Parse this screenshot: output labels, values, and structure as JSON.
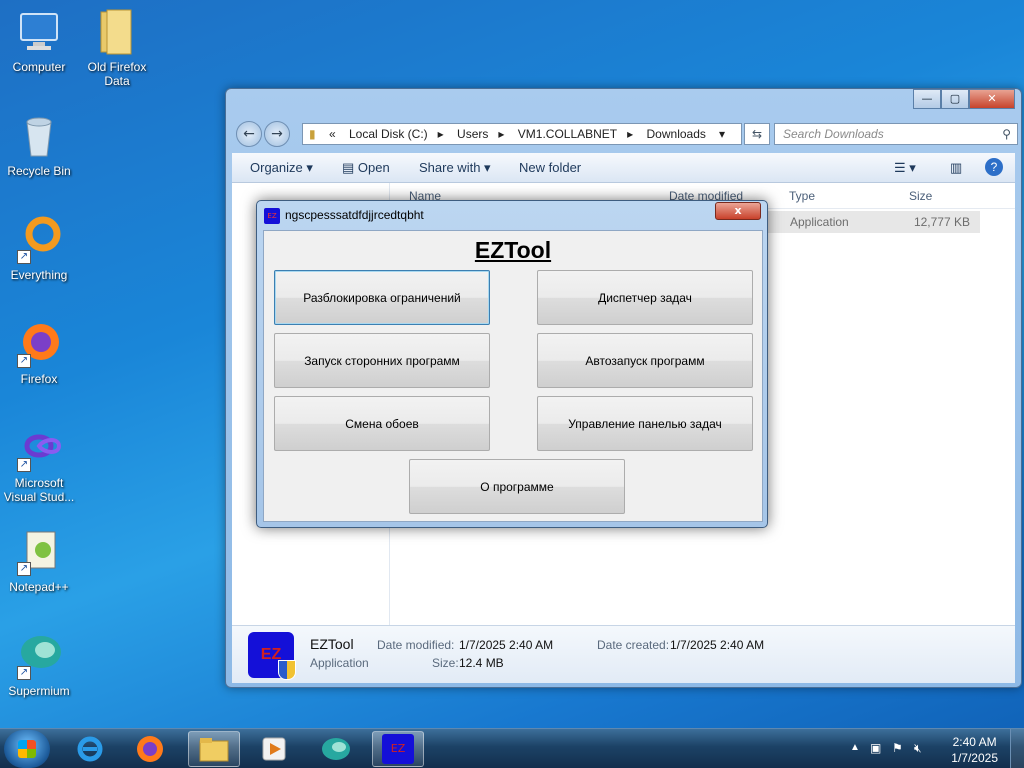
{
  "desktop": {
    "icons": [
      {
        "label": "Computer"
      },
      {
        "label": "Old Firefox Data"
      },
      {
        "label": "Recycle Bin"
      },
      {
        "label": "Everything"
      },
      {
        "label": "Firefox"
      },
      {
        "label": "Microsoft Visual Stud..."
      },
      {
        "label": "Notepad++"
      },
      {
        "label": "Supermium"
      }
    ]
  },
  "explorer": {
    "path_prefix": "«",
    "path": [
      "Local Disk (C:)",
      "Users",
      "VM1.COLLABNET",
      "Downloads"
    ],
    "search_placeholder": "Search Downloads",
    "toolbar": {
      "organize": "Organize",
      "open": "Open",
      "share_with": "Share with",
      "new_folder": "New folder"
    },
    "columns": {
      "name": "Name",
      "date_modified": "Date modified",
      "type": "Type",
      "size": "Size"
    },
    "file": {
      "type": "Application",
      "size": "12,777 KB"
    },
    "details": {
      "name": "EZTool",
      "kind": "Application",
      "date_modified_label": "Date modified:",
      "date_modified": "1/7/2025 2:40 AM",
      "size_label": "Size:",
      "size": "12.4 MB",
      "date_created_label": "Date created:",
      "date_created": "1/7/2025 2:40 AM",
      "icon_text": "EZ"
    }
  },
  "dialog": {
    "title": "ngscpesssatdfdjjrcedtqbht",
    "heading": "EZTool",
    "close": "x",
    "buttons": {
      "unlock": "Разблокировка ограничений",
      "task_manager": "Диспетчер задач",
      "run_third_party": "Запуск сторонних программ",
      "autostart": "Автозапуск программ",
      "wallpaper": "Смена обоев",
      "taskbar_control": "Управление панелью задач",
      "about": "О программе"
    }
  },
  "taskbar": {
    "ez_label": "EZ",
    "time": "2:40 AM",
    "date": "1/7/2025"
  }
}
